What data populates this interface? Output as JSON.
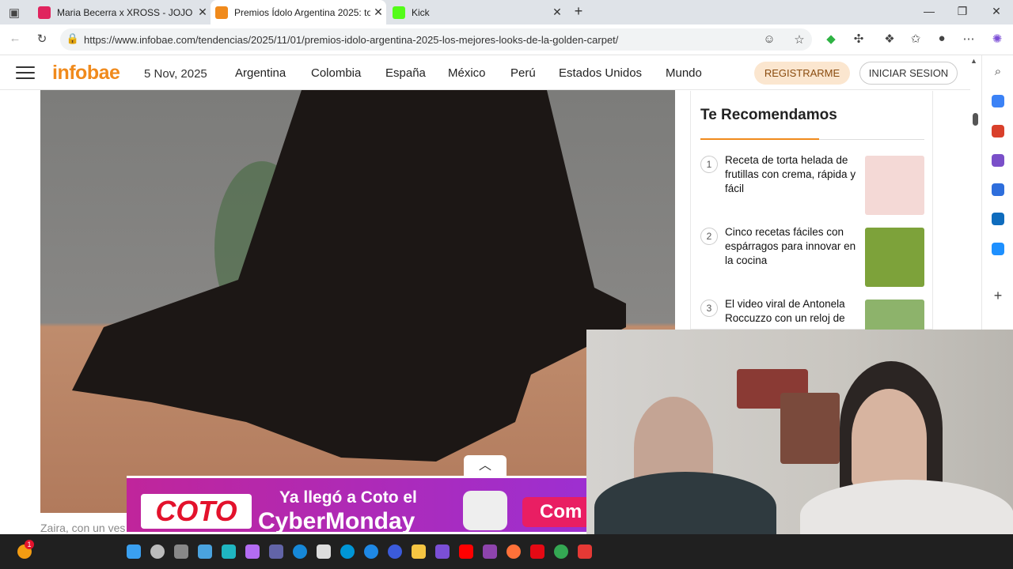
{
  "browser": {
    "tabs": [
      {
        "title": "Maria Becerra x XROSS - JOJO (OF",
        "favicon_color": "#e0245e"
      },
      {
        "title": "Premios Ídolo Argentina 2025: to",
        "favicon_color": "#f08a1c"
      },
      {
        "title": "Kick",
        "favicon_color": "#53fc18"
      }
    ],
    "new_tab": "+",
    "url": "https://www.infobae.com/tendencias/2025/11/01/premios-idolo-argentina-2025-los-mejores-looks-de-la-golden-carpet/"
  },
  "site": {
    "logo": "infobae",
    "date": "5 Nov, 2025",
    "nav": [
      "Argentina",
      "Colombia",
      "España",
      "México",
      "Perú",
      "Estados Unidos",
      "Mundo"
    ],
    "register": "REGISTRARME",
    "login": "INICIAR SESION",
    "caption": "Zaira, con un ves"
  },
  "recommended": {
    "title": "Te Recomendamos",
    "items": [
      {
        "num": "1",
        "text": "Receta de torta helada de frutillas con crema, rápida y fácil",
        "thumb_color": "#f4d9d6"
      },
      {
        "num": "2",
        "text": "Cinco recetas fáciles con espárragos para innovar en la cocina",
        "thumb_color": "#7da23a"
      },
      {
        "num": "3",
        "text": "El video viral de Antonela Roccuzzo con un reloj de",
        "thumb_color": "#8db36b"
      }
    ]
  },
  "ad": {
    "logo": "COTO",
    "line1": "Ya llegó a Coto el",
    "line2": "CyberMonday",
    "cta": "Com"
  },
  "taskbar": {
    "badge": "1"
  }
}
